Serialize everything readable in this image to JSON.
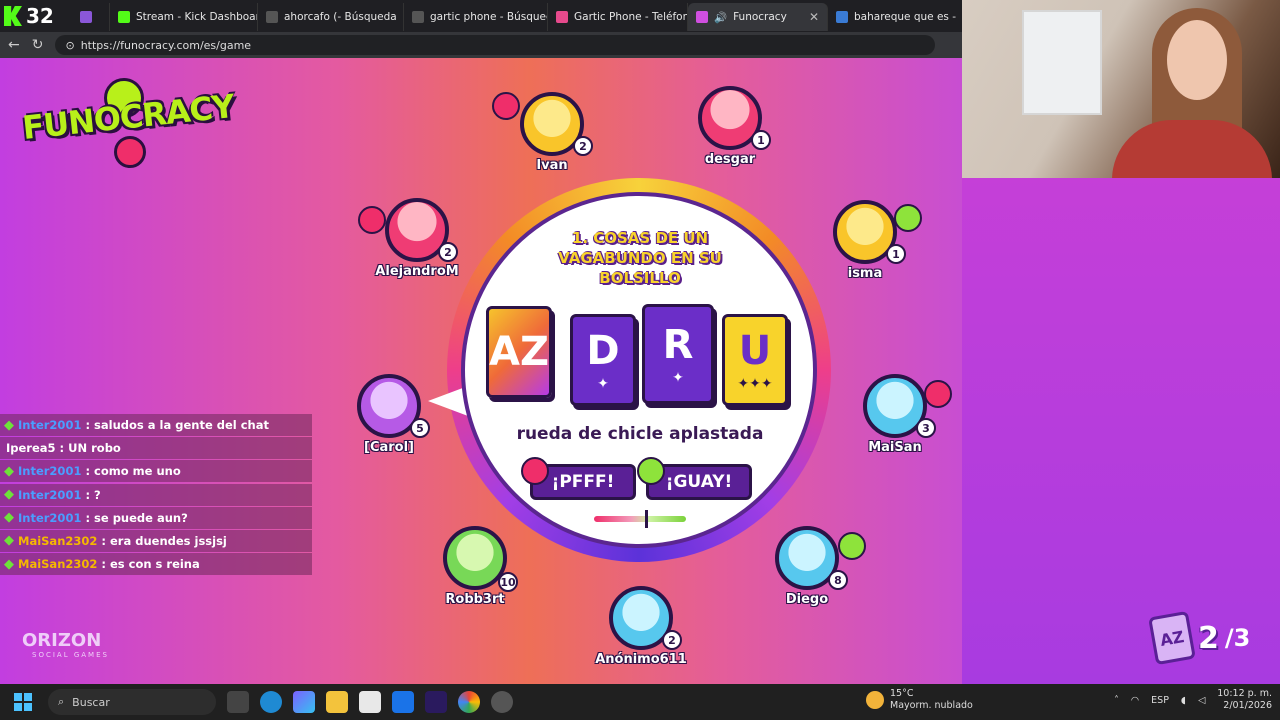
{
  "browser": {
    "kick_count": "32",
    "tabs": [
      {
        "label": "",
        "favicon_color": "#8a57d8"
      },
      {
        "label": "Stream - Kick Dashboard",
        "favicon_color": "#53fc18"
      },
      {
        "label": "ahorcafo (- Búsqueda",
        "favicon_color": "#555555"
      },
      {
        "label": "gartic phone - Búsqueda",
        "favicon_color": "#555555"
      },
      {
        "label": "Gartic Phone - Teléfono I",
        "favicon_color": "#e64a8c"
      },
      {
        "label": "Funocracy",
        "favicon_color": "#d04fe0"
      },
      {
        "label": "bahareque que es - Búsq",
        "favicon_color": "#3a7bd5"
      }
    ],
    "close_glyph": "✕",
    "url": "https://funocracy.com/es/game"
  },
  "game": {
    "logo_text": "FUNOCRACY",
    "prompt_title": "1. COSAS DE UN VAGABUNDO EN SU BOLSILLO",
    "cards": [
      {
        "letter": "AZ",
        "stars": "",
        "style": "az"
      },
      {
        "letter": "D",
        "stars": "✦",
        "style": "purple"
      },
      {
        "letter": "R",
        "stars": "✦",
        "style": "purple"
      },
      {
        "letter": "U",
        "stars": "✦✦✦",
        "style": "yellow"
      }
    ],
    "answer": "rueda de chicle aplastada",
    "btn_pfff": "¡PFFF!",
    "btn_guay": "¡GUAY!",
    "vote_meter": 0.55,
    "players": [
      {
        "name": "Ivan",
        "score": "2"
      },
      {
        "name": "desgar",
        "score": "1"
      },
      {
        "name": "AlejandroM",
        "score": "2"
      },
      {
        "name": "isma",
        "score": "1"
      },
      {
        "name": "[Carol]",
        "score": "5"
      },
      {
        "name": "MaiSan",
        "score": "3"
      },
      {
        "name": "Robb3rt",
        "score": "10"
      },
      {
        "name": "Diego",
        "score": "8"
      },
      {
        "name": "Anónimo611",
        "score": "2"
      }
    ],
    "brand": "ORIZON",
    "brand_sub": "SOCIAL GAMES",
    "round_icon": "AZ",
    "round_current": "2",
    "round_total": "/3"
  },
  "chat": [
    {
      "user": "Inter2001",
      "msg": ": saludos a la gente del chat",
      "user_color": "#4a9eff",
      "badge": true
    },
    {
      "user": "Iperea5",
      "msg": ": UN robo",
      "user_color": "#ffffff",
      "badge": false
    },
    {
      "user": "Inter2001",
      "msg": ": como me uno",
      "user_color": "#4a9eff",
      "badge": true
    },
    {
      "user": "Inter2001",
      "msg": ": ?",
      "user_color": "#4a9eff",
      "badge": true
    },
    {
      "user": "Inter2001",
      "msg": ": se puede aun?",
      "user_color": "#4a9eff",
      "badge": true
    },
    {
      "user": "MaiSan2302",
      "msg": ": era duendes jssjsj",
      "user_color": "#f5b800",
      "badge": true
    },
    {
      "user": "MaiSan2302",
      "msg": ": es con s reina",
      "user_color": "#f5b800",
      "badge": true
    }
  ],
  "taskbar": {
    "search_placeholder": "Buscar",
    "weather_temp": "15°C",
    "weather_desc": "Mayorm. nublado",
    "lang": "ESP",
    "time": "10:12 p. m.",
    "date": "2/01/2026"
  }
}
